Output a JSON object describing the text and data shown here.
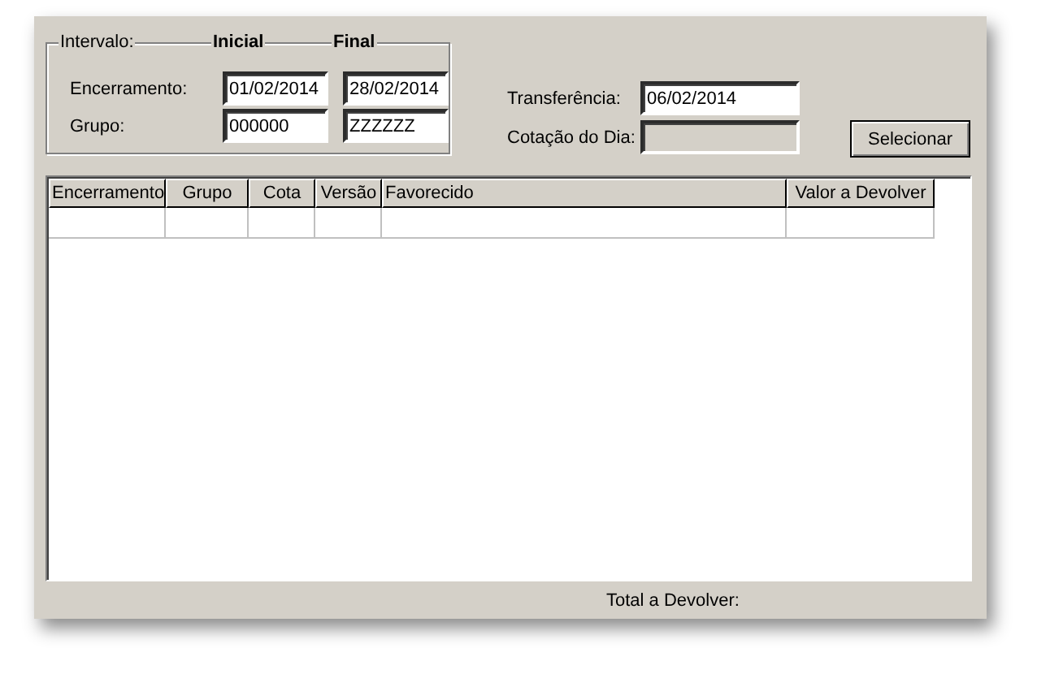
{
  "filter": {
    "legend": "Intervalo:",
    "columns": [
      "Inicial",
      "Final"
    ],
    "rows": [
      {
        "label": "Encerramento:",
        "start": "01/02/2014",
        "end": "28/02/2014"
      },
      {
        "label": "Grupo:",
        "start": "000000",
        "end": "ZZZZZZ"
      }
    ]
  },
  "transfer": {
    "label": "Transferência:",
    "value": "06/02/2014"
  },
  "quote": {
    "label": "Cotação do Dia:",
    "disabled": true
  },
  "select_button": "Selecionar",
  "table": {
    "columns": [
      "Encerramento",
      "Grupo",
      "Cota",
      "Versão",
      "Favorecido",
      "Valor a Devolver"
    ]
  },
  "total_label": "Total a Devolver:"
}
